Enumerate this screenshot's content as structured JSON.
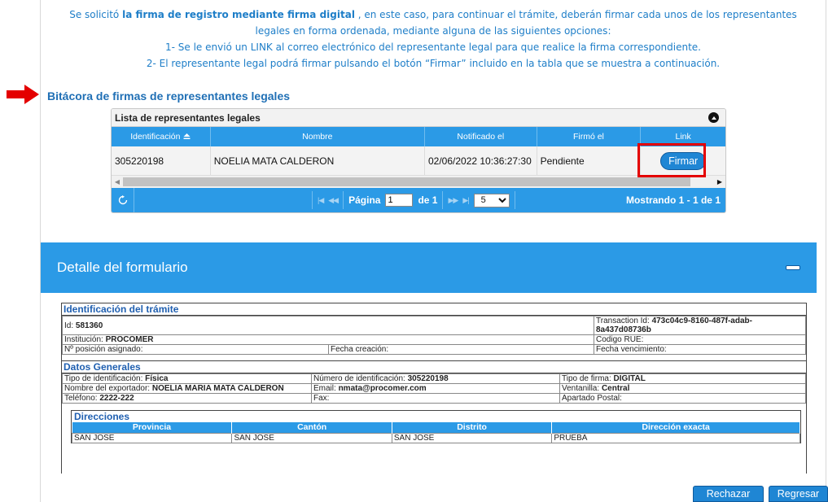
{
  "instructions": {
    "line1_pre": "Se solicitó ",
    "line1_bold": "la firma de registro mediante firma digital",
    "line1_post": " , en este caso, para continuar el trámite, deberán firmar cada unos de los representantes",
    "line2": "legales en forma ordenada, mediante alguna de las siguientes opciones:",
    "line3": "1- Se le envió un LINK al correo electrónico del representante legal para que realice la firma correspondiente.",
    "line4": "2- El representante legal podrá firmar pulsando el botón “Firmar” incluido en la tabla que se muestra a continuación."
  },
  "log": {
    "title": "Bitácora de firmas de representantes legales",
    "caption": "Lista de representantes legales",
    "columns": [
      "Identificación",
      "Nombre",
      "Notificado el",
      "Firmó el",
      "Link"
    ],
    "rows": [
      {
        "id": "305220198",
        "nombre": "NOELIA MATA CALDERON",
        "notificado": "02/06/2022 10:36:27:30",
        "firmo": "Pendiente",
        "link_label": "Firmar"
      }
    ],
    "pager": {
      "page_label": "Página",
      "page_value": "1",
      "of_label": "de 1",
      "page_size": "5",
      "status": "Mostrando 1 - 1 de 1"
    }
  },
  "detail": {
    "title": "Detalle del formulario",
    "identificacion": {
      "title": "Identificación del trámite",
      "id_label": "Id: ",
      "id_value": "581360",
      "transaction_label": "Transaction Id: ",
      "transaction_value": "473c04c9-8160-487f-adab-8a437d08736b",
      "institucion_label": "Institución: ",
      "institucion_value": "PROCOMER",
      "rue_label": "Codigo RUE:",
      "posicion_label": "Nº posición asignado:",
      "creacion_label": "Fecha creación:",
      "vencimiento_label": "Fecha vencimiento:"
    },
    "datos": {
      "title": "Datos Generales",
      "tipo_id_label": "Tipo de identificación: ",
      "tipo_id_value": "Física",
      "num_id_label": "Número de identificación: ",
      "num_id_value": "305220198",
      "tipo_firma_label": "Tipo de firma: ",
      "tipo_firma_value": "DIGITAL",
      "exportador_label": "Nombre del exportador: ",
      "exportador_value": "NOELIA MARIA MATA CALDERON",
      "email_label": "Email: ",
      "email_value": "nmata@procomer.com",
      "ventanilla_label": "Ventanilla: ",
      "ventanilla_value": "Central",
      "telefono_label": "Teléfono: ",
      "telefono_value": "2222-222",
      "fax_label": "Fax:",
      "apartado_label": "Apartado Postal:"
    },
    "direcciones": {
      "title": "Direcciones",
      "columns": [
        "Provincia",
        "Cantón",
        "Distrito",
        "Dirección exacta"
      ],
      "row": [
        "SAN JOSE",
        "SAN JOSE",
        "SAN JOSE",
        "PRUEBA"
      ]
    }
  },
  "footer": {
    "reject_label": "Rechazar",
    "back_label": "Regresar"
  },
  "colors": {
    "accent": "#2b9ae6",
    "instruction_text": "#1e7ec8",
    "highlight": "#e40000"
  },
  "icons": [
    "red-arrow-icon",
    "collapse-icon",
    "sort-asc-icon",
    "refresh-icon",
    "first-page-icon",
    "prev-page-icon",
    "next-page-icon",
    "last-page-icon",
    "chevron-down-icon",
    "scroll-left-icon",
    "scroll-right-icon",
    "minimize-icon"
  ]
}
